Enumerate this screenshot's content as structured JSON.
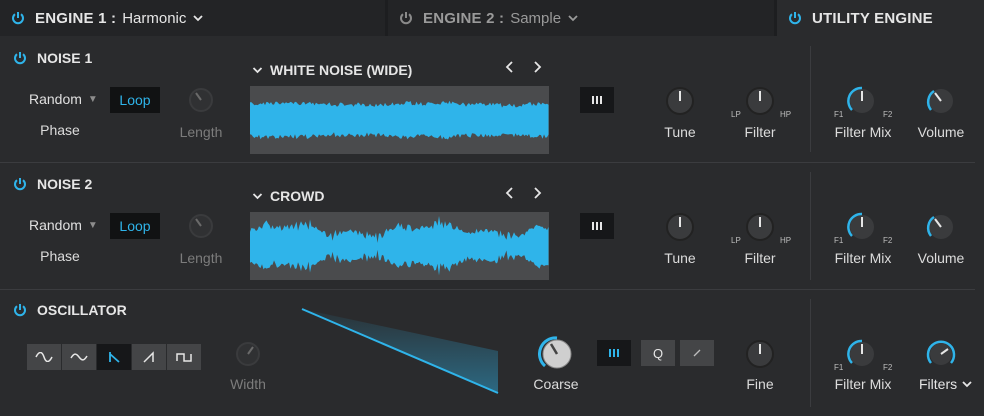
{
  "header": {
    "engine1": {
      "title": "ENGINE 1 :",
      "value": "Harmonic"
    },
    "engine2": {
      "title": "ENGINE 2 :",
      "value": "Sample"
    },
    "utility": {
      "title": "UTILITY ENGINE"
    }
  },
  "noise1": {
    "title": "NOISE 1",
    "phase_mode": "Random",
    "phase_label": "Phase",
    "loop_label": "Loop",
    "length_label": "Length",
    "sample_name": "WHITE NOISE (WIDE)",
    "tune_label": "Tune",
    "filter_label": "Filter",
    "lp": "LP",
    "hp": "HP",
    "filter_mix_label": "Filter Mix",
    "f1": "F1",
    "f2": "F2",
    "volume_label": "Volume"
  },
  "noise2": {
    "title": "NOISE 2",
    "phase_mode": "Random",
    "phase_label": "Phase",
    "loop_label": "Loop",
    "length_label": "Length",
    "sample_name": "CROWD",
    "tune_label": "Tune",
    "filter_label": "Filter",
    "lp": "LP",
    "hp": "HP",
    "filter_mix_label": "Filter Mix",
    "f1": "F1",
    "f2": "F2",
    "volume_label": "Volume"
  },
  "oscillator": {
    "title": "OSCILLATOR",
    "width_label": "Width",
    "coarse_label": "Coarse",
    "q_label": "Q",
    "fine_label": "Fine",
    "filter_mix_label": "Filter Mix",
    "f1": "F1",
    "f2": "F2",
    "filters_label": "Filters",
    "waveforms": [
      "sine-icon",
      "triangle-icon",
      "saw-down-icon",
      "saw-up-icon",
      "square-icon"
    ],
    "selected_waveform": "saw-down-icon"
  },
  "colors": {
    "accent": "#2fb4ea",
    "background": "#2a2b2d",
    "topbar": "#1d1e20",
    "waveform_bg": "#4a4b4d"
  }
}
